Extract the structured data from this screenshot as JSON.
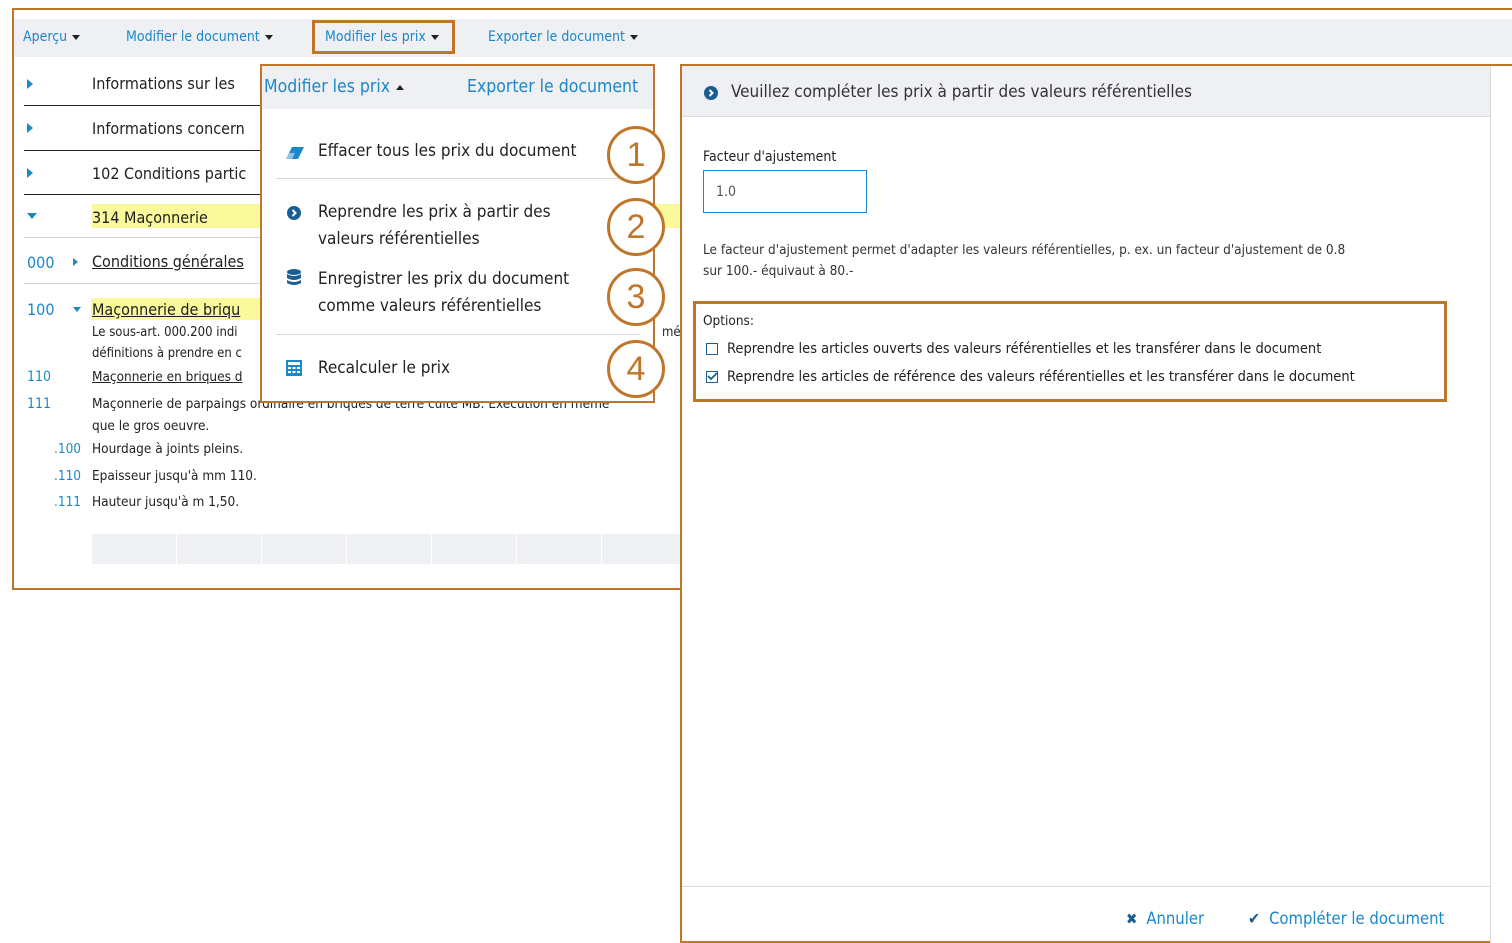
{
  "toolbar": {
    "apercu": "Aperçu",
    "modifier_document": "Modifier le document",
    "modifier_prix": "Modifier les prix",
    "exporter_document": "Exporter le document"
  },
  "document": {
    "rows": [
      {
        "label": "Informations sur les"
      },
      {
        "label": "Informations concern"
      },
      {
        "label": "102 Conditions partic"
      },
      {
        "label": "314 Maçonnerie"
      }
    ],
    "section_000_num": "000",
    "section_000_label": "Conditions générales",
    "section_100_num": "100",
    "section_100_label": "Maçonnerie de briqu",
    "text_100_line1": "Le sous-art. 000.200 indi",
    "text_100_right": "mé",
    "text_100_line2": "définitions à prendre en c",
    "item_110_num": "110",
    "item_110_label": "Maçonnerie en briques d",
    "item_111_num": "111",
    "item_111_label": "Maçonnerie de parpaings ordinaire en briques de terre cuite MB. Exécution en même",
    "item_111_cont": "que le gros oeuvre.",
    "subitems": [
      {
        "num": ".100",
        "label": "Hourdage à joints pleins."
      },
      {
        "num": ".110",
        "label": "Epaisseur jusqu'à mm 110."
      },
      {
        "num": ".111",
        "label": "Hauteur jusqu'à m 1,50."
      }
    ]
  },
  "dropdown": {
    "header_modifier": "Modifier les prix",
    "header_exporter": "Exporter le document",
    "items": [
      {
        "label": "Effacer tous les prix du document",
        "icon": "eraser-icon"
      },
      {
        "label_l1": "Reprendre les prix à partir des",
        "label_l2": "valeurs référentielles",
        "icon": "chevron-circle-right-icon"
      },
      {
        "label_l1": "Enregistrer les prix du document",
        "label_l2": "comme valeurs référentielles",
        "icon": "database-icon"
      },
      {
        "label": "Recalculer le prix",
        "icon": "calculator-icon"
      }
    ]
  },
  "callouts": [
    "1",
    "2",
    "3",
    "4"
  ],
  "dialog": {
    "title": "Veuillez compléter les prix à partir des valeurs référentielles",
    "factor_label": "Facteur d'ajustement",
    "factor_value": "1.0",
    "help_line1": "Le facteur d'ajustement permet d'adapter les valeurs référentielles, p. ex. un facteur d'ajustement de 0.8",
    "help_line2": "sur 100.- équivaut à 80.-",
    "options_label": "Options:",
    "option1": "Reprendre les articles ouverts des valeurs référentielles et les transférer dans le document",
    "option1_checked": false,
    "option2": "Reprendre les articles de référence des valeurs référentielles et les transférer dans le document",
    "option2_checked": true,
    "cancel": "Annuler",
    "complete": "Compléter le document"
  },
  "colors": {
    "accent_blue": "#1a88c9",
    "highlight_orange": "#c0762a",
    "highlight_yellow": "#fafa9c",
    "toolbar_bg": "#eef0f4"
  }
}
